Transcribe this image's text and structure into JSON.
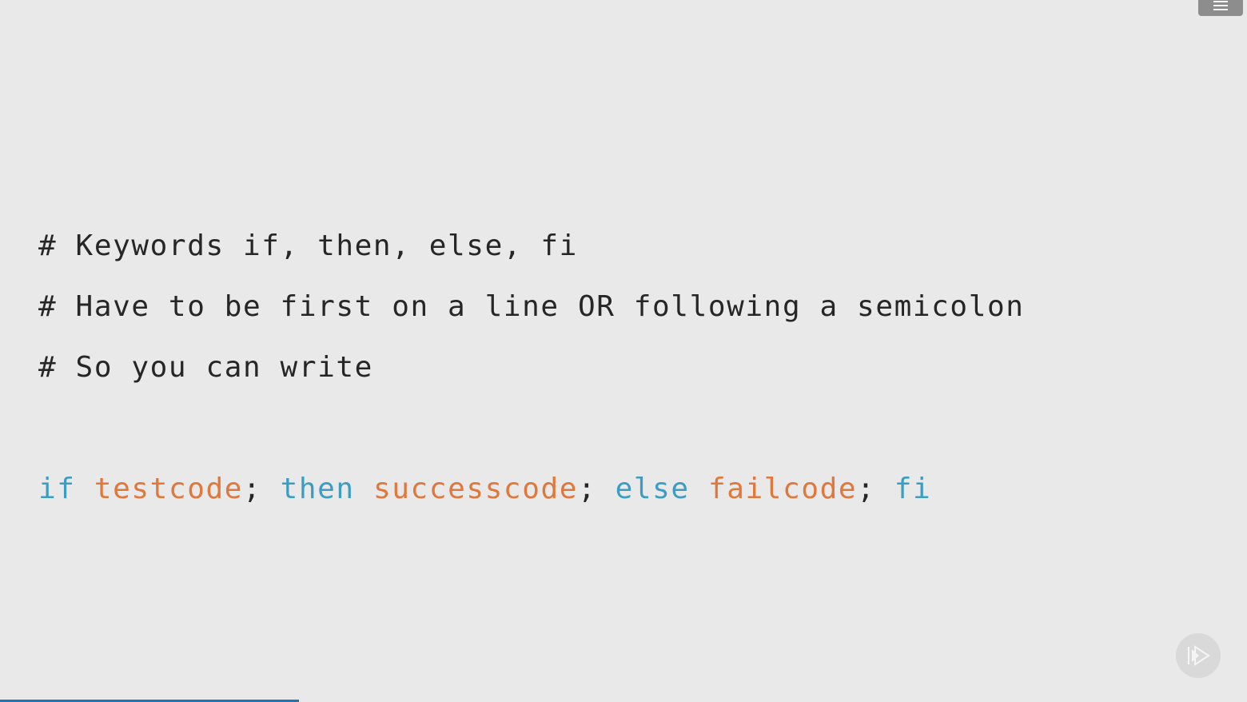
{
  "slide": {
    "comments": [
      "# Keywords if, then, else, fi",
      "# Have to be first on a line OR following a semicolon",
      "# So you can write"
    ],
    "code": {
      "kw_if": "if",
      "cmd_test": "testcode",
      "semi_1": ";",
      "kw_then": "then",
      "cmd_success": "successcode",
      "semi_2": ";",
      "kw_else": "else",
      "cmd_fail": "failcode",
      "semi_3": ";",
      "kw_fi": "fi"
    }
  },
  "icons": {
    "menu": "hamburger-menu-icon",
    "logo": "pluralsight-play-icon"
  },
  "colors": {
    "background": "#e9e9e9",
    "keyword": "#3b9cc4",
    "command": "#e0773b",
    "text": "#262626",
    "progress": "#1b78b0"
  },
  "playback": {
    "progress_fraction": 0.24
  }
}
